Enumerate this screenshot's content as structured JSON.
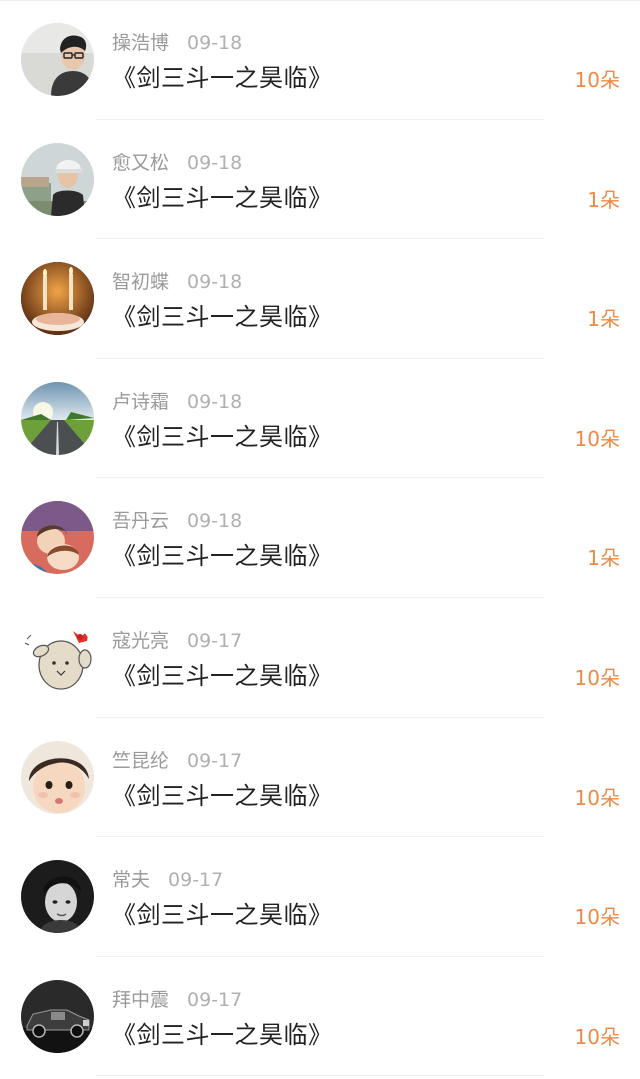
{
  "rows": [
    {
      "name": "操浩博",
      "date": "09-18",
      "title": "《剑三斗一之昊临》",
      "amount": "10朵",
      "avatar": "man-glasses-photo"
    },
    {
      "name": "愈又松",
      "date": "09-18",
      "title": "《剑三斗一之昊临》",
      "amount": "1朵",
      "avatar": "man-cap-street-photo"
    },
    {
      "name": "智初蝶",
      "date": "09-18",
      "title": "《剑三斗一之昊临》",
      "amount": "1朵",
      "avatar": "candles-cake-photo"
    },
    {
      "name": "卢诗霜",
      "date": "09-18",
      "title": "《剑三斗一之昊临》",
      "amount": "10朵",
      "avatar": "road-landscape-photo"
    },
    {
      "name": "吾丹云",
      "date": "09-18",
      "title": "《剑三斗一之昊临》",
      "amount": "1朵",
      "avatar": "anime-couple-illustration"
    },
    {
      "name": "寇光亮",
      "date": "09-17",
      "title": "《剑三斗一之昊临》",
      "amount": "10朵",
      "avatar": "cartoon-bunny-bow"
    },
    {
      "name": "竺昆纶",
      "date": "09-17",
      "title": "《剑三斗一之昊临》",
      "amount": "10朵",
      "avatar": "child-face-photo"
    },
    {
      "name": "常夫",
      "date": "09-17",
      "title": "《剑三斗一之昊临》",
      "amount": "10朵",
      "avatar": "boy-portrait-bw"
    },
    {
      "name": "拜中震",
      "date": "09-17",
      "title": "《剑三斗一之昊临》",
      "amount": "10朵",
      "avatar": "vintage-car-bw"
    }
  ],
  "colors": {
    "amount": "#ec8a45",
    "name": "#9a9a9a",
    "title": "#222222"
  }
}
